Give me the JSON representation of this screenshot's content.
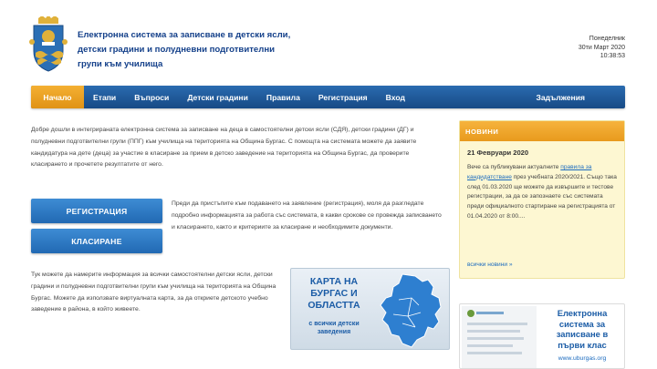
{
  "header": {
    "title": "Електронна система за записване в детски ясли, детски градини и полудневни подготвителни групи към училища",
    "day": "Понеделник",
    "date": "30ти Март 2020",
    "time": "10:38:53"
  },
  "nav": {
    "items": [
      {
        "label": "Начало",
        "active": true
      },
      {
        "label": "Етапи"
      },
      {
        "label": "Въпроси"
      },
      {
        "label": "Детски градини"
      },
      {
        "label": "Правила"
      },
      {
        "label": "Регистрация"
      },
      {
        "label": "Вход"
      },
      {
        "label": "Задължения"
      }
    ],
    "active_color": "#f0a42a",
    "bar_color": "#1f5a99"
  },
  "intro": {
    "text": "Добре дошли в интегрираната електронна система за записване на деца в самостоятелни детски ясли (СДЯ), детски градини (ДГ) и полудневни подготвителни групи (ППГ) към училища на територията на Община Бургас. С помощта на системата можете да заявите кандидатура на дете (деца) за участие в класиране за прием в детско заведение на територията на Община Бургас, да проверите класирането и прочетете резултатите от него."
  },
  "buttons": {
    "register": "РЕГИСТРАЦИЯ",
    "ranking": "КЛАСИРАНЕ"
  },
  "mid_text": "Преди да пристъпите към подаването на заявление (регистрация), моля да разгледате подробно информацията за работа със системата, в какви срокове се провежда записването и класирането, както и критериите за класиране и необходимите документи.",
  "map_text": "Тук можете да намерите информация за всички самостоятелни детски ясли, детски градини и полудневни подготвителни групи към училища на територията на Община Бургас. Можете да използвате виртуалната карта, за да откриете детското учебно заведение в района, в който живеете.",
  "map_box": {
    "title": "КАРТА НА БУРГАС И ОБЛАСТТА",
    "subtitle": "с всички детски заведения"
  },
  "news": {
    "heading": "НОВИНИ",
    "date": "21 Февруари 2020",
    "text_before": "Вече са публикувани актуалните ",
    "link": "правила за кандидатстване",
    "text_after": " през учебната 2020/2021. Също така след 01.03.2020 ще можете да извършите и тестове регистрации, за да се запознаете със системата преди официалното стартиране на регистрацията от 01.04.2020 от 8:00....",
    "more": "всички новини »"
  },
  "banner": {
    "text": "Електронна система за записване в първи клас",
    "url": "www.uburgas.org"
  }
}
